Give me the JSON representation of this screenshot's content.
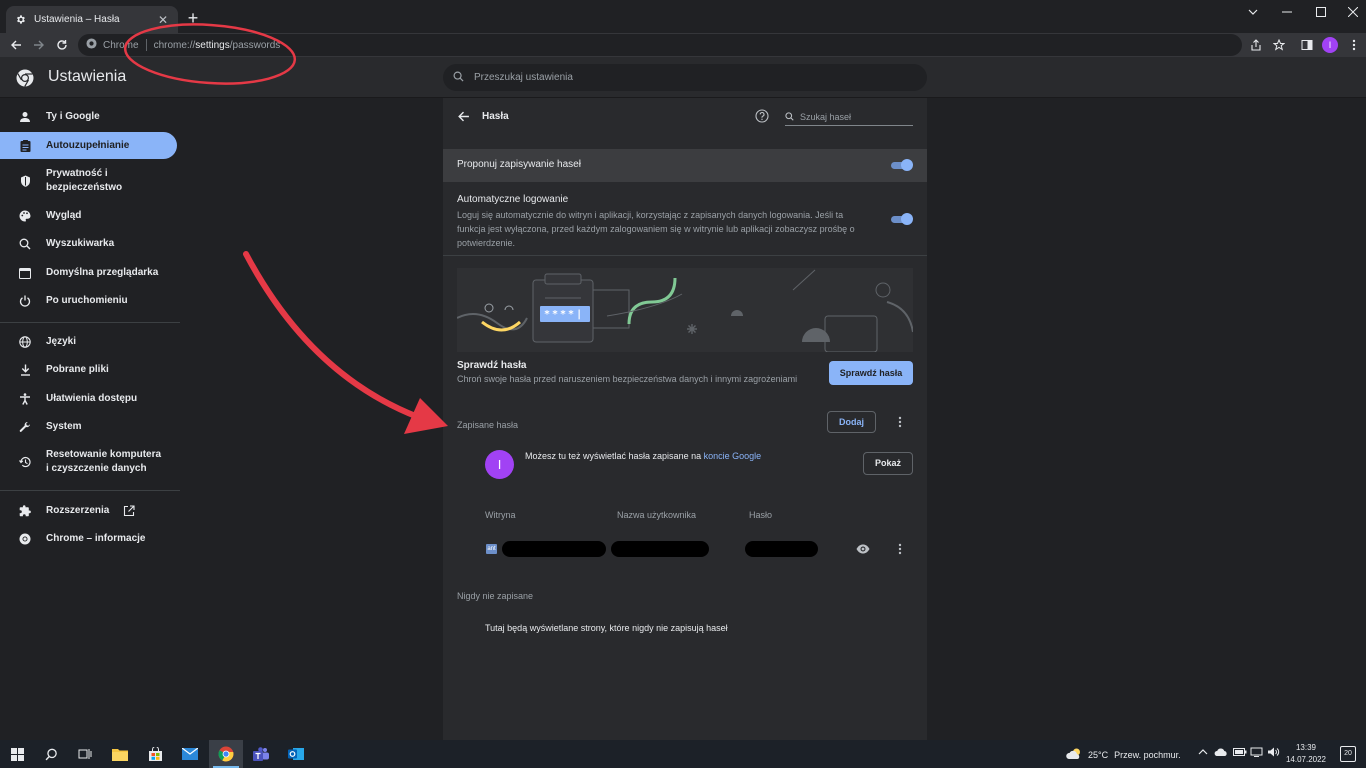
{
  "browser": {
    "tab_title": "Ustawienia – Hasła",
    "site_chip": "Chrome",
    "url_prefix": "chrome://",
    "url_host": "settings",
    "url_path": "/passwords",
    "avatar_letter": "I"
  },
  "settings_header": {
    "title": "Ustawienia",
    "search_placeholder": "Przeszukaj ustawienia"
  },
  "sidebar": {
    "items": [
      {
        "label": "Ty i Google",
        "icon": "person-icon"
      },
      {
        "label": "Autouzupełnianie",
        "icon": "clipboard-icon",
        "active": true
      },
      {
        "label": "Prywatność i bezpieczeństwo",
        "icon": "shield-icon"
      },
      {
        "label": "Wygląd",
        "icon": "palette-icon"
      },
      {
        "label": "Wyszukiwarka",
        "icon": "search-icon"
      },
      {
        "label": "Domyślna przeglądarka",
        "icon": "browser-icon"
      },
      {
        "label": "Po uruchomieniu",
        "icon": "power-icon"
      },
      {
        "label": "Języki",
        "icon": "globe-icon"
      },
      {
        "label": "Pobrane pliki",
        "icon": "download-icon"
      },
      {
        "label": "Ułatwienia dostępu",
        "icon": "accessibility-icon"
      },
      {
        "label": "System",
        "icon": "wrench-icon"
      },
      {
        "label": "Resetowanie komputera i czyszczenie danych",
        "icon": "history-icon"
      },
      {
        "label": "Rozszerzenia",
        "icon": "puzzle-icon"
      },
      {
        "label": "Chrome – informacje",
        "icon": "chrome-icon"
      }
    ]
  },
  "passwords": {
    "title": "Hasła",
    "search_placeholder": "Szukaj haseł",
    "offer_save_label": "Proponuj zapisywanie haseł",
    "auto_signin_label": "Automatyczne logowanie",
    "auto_signin_desc": "Loguj się automatycznie do witryn i aplikacji, korzystając z zapisanych danych logowania. Jeśli ta funkcja jest wyłączona, przed każdym zalogowaniem się w witrynie lub aplikacji zobaczysz prośbę o potwierdzenie.",
    "illustration_code": "****|",
    "check_title": "Sprawdź hasła",
    "check_desc": "Chroń swoje hasła przed naruszeniem bezpieczeństwa danych i innymi zagrożeniami",
    "check_button": "Sprawdź hasła",
    "saved_title": "Zapisane hasła",
    "add_button": "Dodaj",
    "account_text": "Możesz tu też wyświetlać hasła zapisane na",
    "account_link": "koncie Google",
    "show_button": "Pokaż",
    "columns": [
      "Witryna",
      "Nazwa użytkownika",
      "Hasło"
    ],
    "site_icon_text": "ant",
    "never_title": "Nigdy nie zapisane",
    "never_desc": "Tutaj będą wyświetlane strony, które nigdy nie zapisują haseł"
  },
  "taskbar": {
    "temperature": "25°C",
    "weather_desc": "Przew. pochmur.",
    "time": "13:39",
    "date": "14.07.2022",
    "notifications": "20"
  },
  "colors": {
    "accent": "#8ab4f8",
    "annotation": "#e53946",
    "avatar": "#a142f4"
  }
}
